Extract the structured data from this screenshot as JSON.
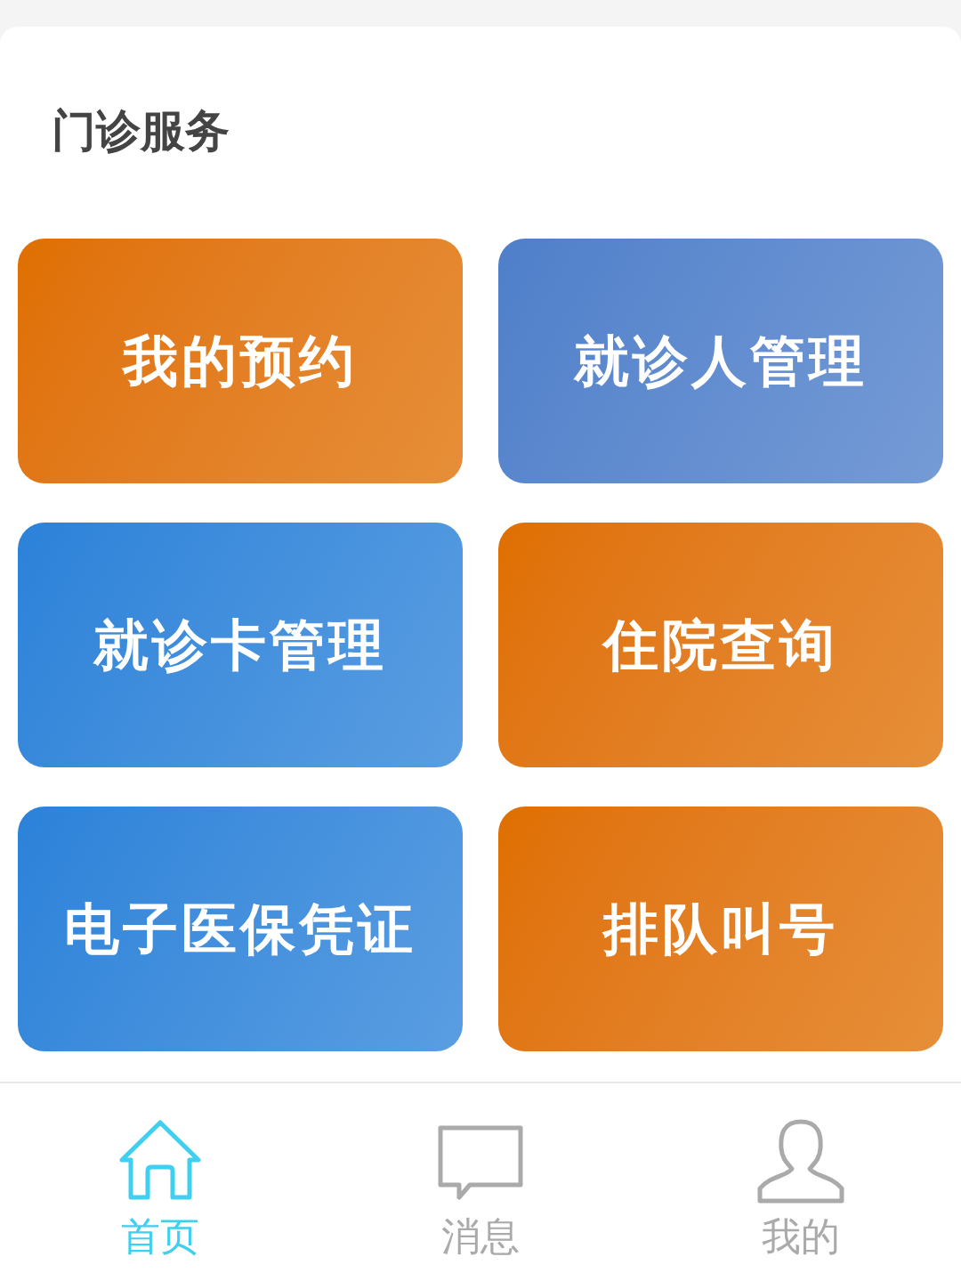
{
  "section": {
    "title": "门诊服务"
  },
  "tiles": [
    {
      "label": "我的预约",
      "color": "#df6f00"
    },
    {
      "label": "就诊人管理",
      "color": "#4f7fca"
    },
    {
      "label": "就诊卡管理",
      "color": "#2b82d9"
    },
    {
      "label": "住院查询",
      "color": "#df6f00"
    },
    {
      "label": "电子医保凭证",
      "color": "#2b82d9"
    },
    {
      "label": "排队叫号",
      "color": "#df6f00"
    }
  ],
  "tab_bar": [
    {
      "label": "首页",
      "kind": "home",
      "selected": true
    },
    {
      "label": "消息",
      "kind": "message",
      "selected": false
    },
    {
      "label": "我的",
      "kind": "person",
      "selected": false
    }
  ]
}
